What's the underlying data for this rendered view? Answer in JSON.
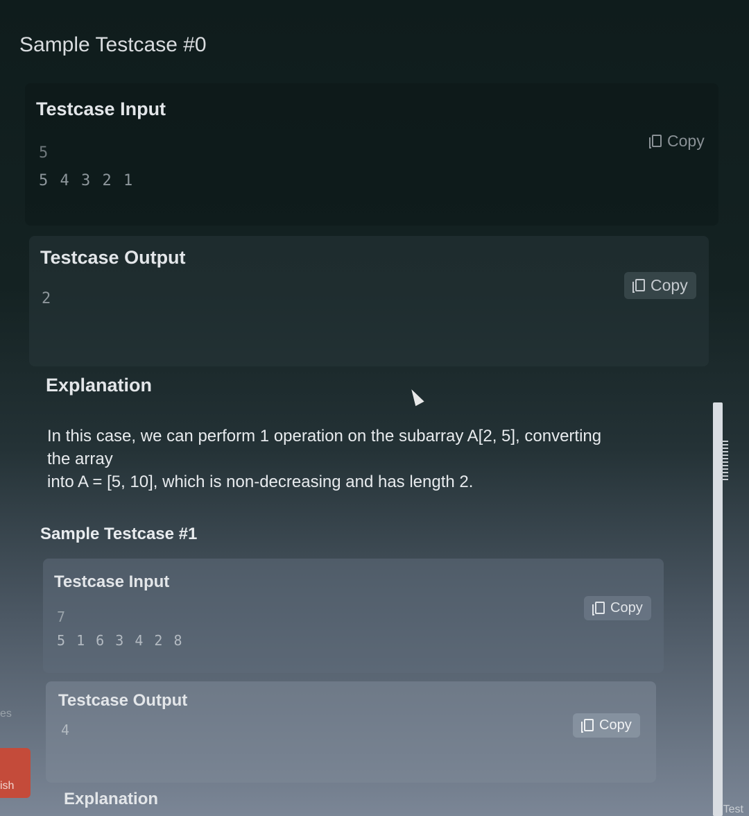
{
  "sample0": {
    "heading": "Sample Testcase #0",
    "input": {
      "title": "Testcase Input",
      "lines": [
        "5",
        "5 4 3 2 1"
      ],
      "copy_label": "Copy"
    },
    "output": {
      "title": "Testcase Output",
      "lines": [
        "2"
      ],
      "copy_label": "Copy"
    },
    "explanation": {
      "title": "Explanation",
      "lines": [
        "In this case, we can perform 1 operation on the subarray A[2, 5], converting",
        "the array",
        "into A = [5, 10], which is non-decreasing and has length 2."
      ]
    }
  },
  "sample1": {
    "heading": "Sample Testcase #1",
    "input": {
      "title": "Testcase Input",
      "lines": [
        "7",
        "5 1 6 3 4 2 8"
      ],
      "copy_label": "Copy"
    },
    "output": {
      "title": "Testcase Output",
      "lines": [
        "4"
      ],
      "copy_label": "Copy"
    },
    "explanation": {
      "title": "Explanation"
    }
  },
  "left_edge": {
    "label_top": "es",
    "label_bottom": "ish"
  },
  "bottom_right": {
    "label": "Test"
  },
  "colors": {
    "accent_tab": "#c44b3a"
  }
}
